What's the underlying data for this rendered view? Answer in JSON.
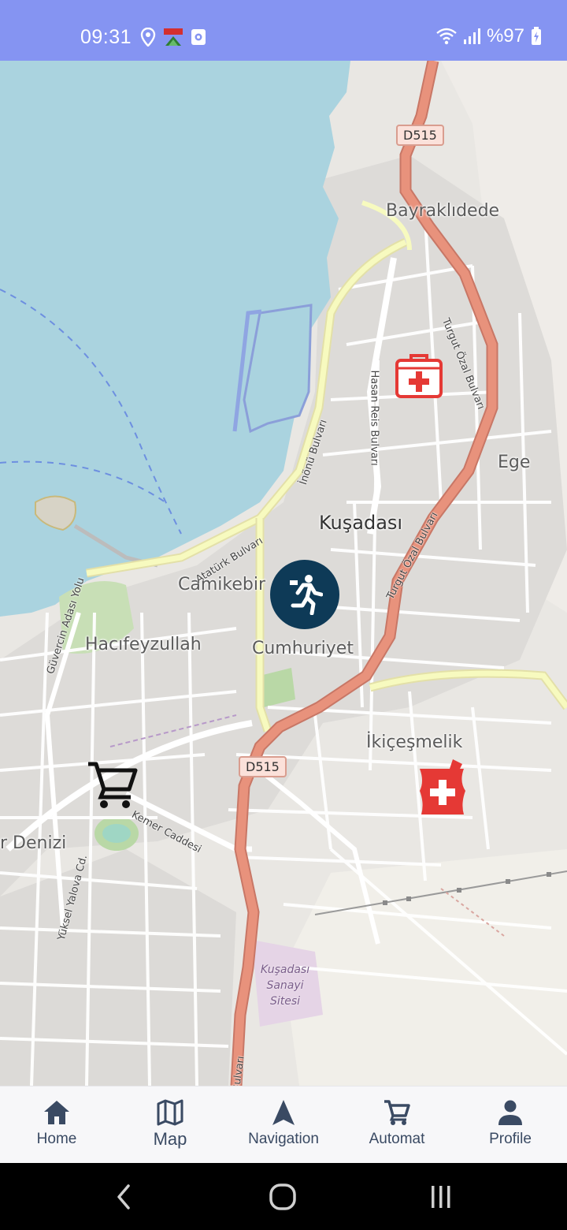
{
  "status_bar": {
    "time": "09:31",
    "battery": "%97",
    "icons": [
      "location-icon",
      "fake-gps-icon",
      "app-notification-icon",
      "wifi-icon",
      "signal-icon",
      "battery-charging-icon"
    ],
    "background_color": "#8594f2"
  },
  "map": {
    "labels": {
      "bayraklidede": "Bayraklıdede",
      "ege": "Ege",
      "kusadasi": "Kuşadası",
      "camikebir": "Camikebir",
      "hacifeyzullah": "Hacıfeyzullah",
      "cumhuriyet": "Cumhuriyet",
      "ikicesmelik": "İkiçeşmelik",
      "denizi": "r Denizi"
    },
    "roads": {
      "d515_top": "D515",
      "d515_bottom": "D515",
      "turgut_ozal_1": "Turgut Özal Bulvarı",
      "turgut_ozal_2": "Turgut Özal Bulvarı",
      "hasan_reis": "Hasan Reis Bulvarı",
      "inonu": "İnönü Bulvarı",
      "ataturk": "Atatürk Bulvarı",
      "guvercin": "Güvercin Adası Yolu",
      "kemer": "Kemer Caddesi",
      "yuksel_yalova": "Yüksel Yalova Cd.",
      "bulvari_bottom": "Bulvarı"
    },
    "industrial_area": "Kuşadası Sanayi Sitesi",
    "markers": [
      {
        "name": "first-aid-kit-marker",
        "icon": "medical-bag-icon",
        "color": "#e53935"
      },
      {
        "name": "pharmacy-marker",
        "icon": "pharmacy-icon",
        "color": "#e53935"
      },
      {
        "name": "shopping-cart-marker",
        "icon": "cart-icon",
        "color": "#111111"
      },
      {
        "name": "user-location-marker",
        "icon": "running-person-icon",
        "color": "#0e3a57"
      }
    ],
    "colors": {
      "sea": "#aad3df",
      "land": "#e9e7e3",
      "primary_road": "#e8927c",
      "secondary_road": "#f7fabf"
    }
  },
  "bottom_nav": {
    "items": [
      {
        "label": "Home",
        "icon": "home-icon"
      },
      {
        "label": "Map",
        "icon": "map-icon"
      },
      {
        "label": "Navigation",
        "icon": "navigation-arrow-icon"
      },
      {
        "label": "Automat",
        "icon": "cart-icon"
      },
      {
        "label": "Profile",
        "icon": "person-icon"
      }
    ],
    "active": "Map"
  },
  "system_nav": {
    "buttons": [
      "back-icon",
      "home-circle-icon",
      "recents-icon"
    ]
  }
}
